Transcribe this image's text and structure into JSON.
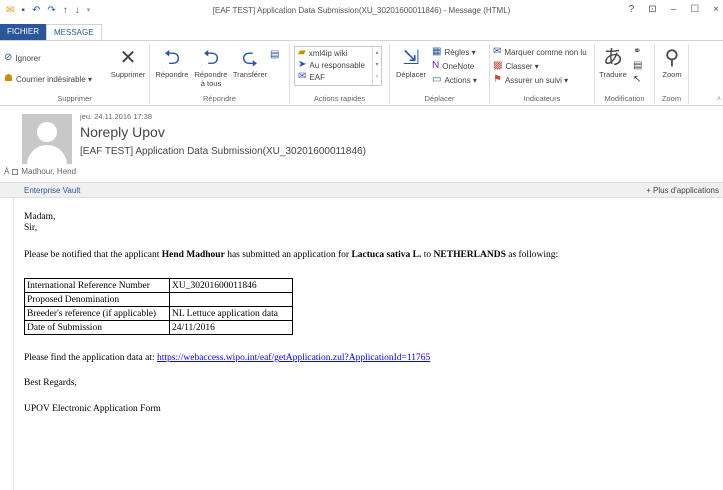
{
  "qat": {
    "icons": [
      "envelope-icon",
      "save-icon",
      "undo-icon",
      "redo-icon",
      "up-arrow-icon",
      "down-arrow-icon"
    ]
  },
  "window": {
    "title": "[EAF TEST] Application Data Submission(XU_30201600011846) - Message (HTML)",
    "help": "?",
    "restore": "⊡",
    "minimize": "–",
    "maximize": "☐",
    "close": "×"
  },
  "tabs": {
    "file": "FICHIER",
    "message": "MESSAGE"
  },
  "ribbon": {
    "supprimer": {
      "ignorer": "Ignorer",
      "courrier": "Courrier indésirable ▾",
      "supprimer_btn": "Supprimer",
      "label": "Supprimer"
    },
    "repondre": {
      "repondre": "Répondre",
      "repondre_tous_1": "Répondre",
      "repondre_tous_2": "à tous",
      "transferer": "Transférer",
      "label": "Répondre"
    },
    "actions": {
      "items": [
        "xml4ip wiki",
        "Au responsable",
        "EAF"
      ],
      "label": "Actions rapides"
    },
    "deplacer": {
      "deplacer": "Déplacer",
      "regles": "Règles ▾",
      "onenote": "OneNote",
      "actions": "Actions ▾",
      "label": "Déplacer"
    },
    "indicateurs": {
      "marquer": "Marquer comme non lu",
      "classer": "Classer ▾",
      "assurer": "Assurer un suivi ▾",
      "label": "Indicateurs"
    },
    "modification": {
      "traduire": "Traduire",
      "label": "Modification"
    },
    "zoom": {
      "zoom": "Zoom",
      "label": "Zoom"
    }
  },
  "header": {
    "date": "jeu. 24.11.2016 17:38",
    "sender": "Noreply Upov",
    "subject": "[EAF TEST] Application Data Submission(XU_30201600011846)",
    "to_prefix": "À",
    "to": "Madhour, Hend"
  },
  "vault": {
    "label": "Enterprise Vault",
    "more": "+ Plus d'applications"
  },
  "mail": {
    "greeting1": "Madam,",
    "greeting2": "Sir,",
    "intro_a": "Please be notified that the applicant ",
    "applicant": "Hend Madhour",
    "intro_b": " has submitted an application for ",
    "species": "Lactuca sativa L.",
    "intro_c": " to ",
    "country": "NETHERLANDS",
    "intro_d": " as following:",
    "table": [
      [
        "International Reference Number",
        "XU_30201600011846"
      ],
      [
        "Proposed Denomination",
        ""
      ],
      [
        "Breeder's reference (if applicable)",
        "NL Lettuce application data"
      ],
      [
        "Date of Submission",
        "24/11/2016"
      ]
    ],
    "find_text": "Please find the application data at: ",
    "link": "https://webaccess.wipo.int/eaf/getApplication.zul?ApplicationId=11765",
    "regards": "Best Regards,",
    "signature": "UPOV Electronic Application Form"
  }
}
